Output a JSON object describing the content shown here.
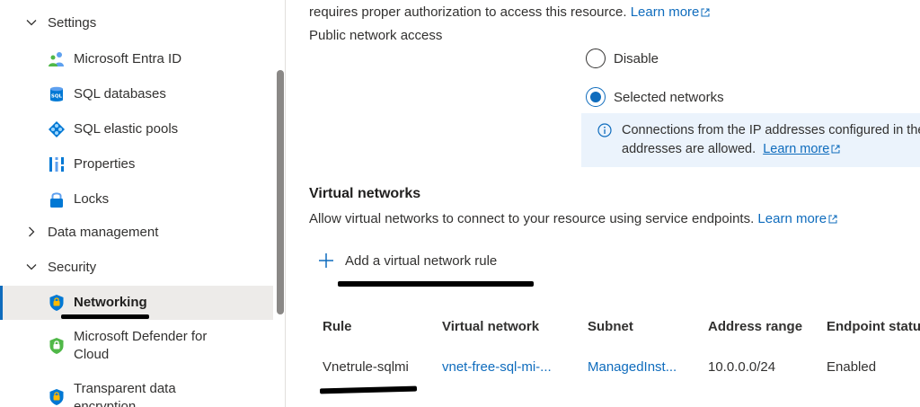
{
  "sidebar": {
    "settings_group": {
      "label": "Settings",
      "expanded": true
    },
    "settings_items": [
      {
        "label": "Microsoft Entra ID",
        "icon": "entra-id-icon"
      },
      {
        "label": "SQL databases",
        "icon": "sql-database-icon"
      },
      {
        "label": "SQL elastic pools",
        "icon": "elastic-pool-icon"
      },
      {
        "label": "Properties",
        "icon": "properties-icon"
      },
      {
        "label": "Locks",
        "icon": "lock-icon"
      }
    ],
    "data_management_group": {
      "label": "Data management",
      "expanded": false
    },
    "security_group": {
      "label": "Security",
      "expanded": true
    },
    "security_items": [
      {
        "label": "Networking",
        "icon": "networking-shield-icon",
        "selected": true
      },
      {
        "label": "Microsoft Defender for Cloud",
        "label_line1": "Microsoft Defender for",
        "label_line2": "Cloud",
        "icon": "defender-shield-icon"
      },
      {
        "label": "Transparent data encryption",
        "label_line1": "Transparent data",
        "label_line2": "encryption",
        "icon": "tde-shield-icon"
      }
    ]
  },
  "main": {
    "auth_text": "requires proper authorization to access this resource.",
    "learn_more": "Learn more",
    "public_network_access_label": "Public network access",
    "radio_options": [
      {
        "label": "Disable",
        "checked": false
      },
      {
        "label": "Selected networks",
        "checked": true
      }
    ],
    "info": {
      "line1": "Connections from the IP addresses configured in the",
      "line2": "addresses are allowed.",
      "link": "Learn more"
    },
    "virtual_networks": {
      "heading": "Virtual networks",
      "description": "Allow virtual networks to connect to your resource using service endpoints.",
      "link": "Learn more",
      "add_rule_label": "Add a virtual network rule"
    },
    "table": {
      "headers": [
        "Rule",
        "Virtual network",
        "Subnet",
        "Address range",
        "Endpoint status"
      ],
      "rows": [
        {
          "rule": "Vnetrule-sqlmi",
          "virtual_network": "vnet-free-sql-mi-...",
          "subnet": "ManagedInst...",
          "address_range": "10.0.0.0/24",
          "endpoint_status": "Enabled"
        }
      ]
    }
  },
  "colors": {
    "accent": "#0f6cbd",
    "selected_bg": "#edebe9",
    "info_bg": "#ebf3fc",
    "text": "#323130"
  }
}
